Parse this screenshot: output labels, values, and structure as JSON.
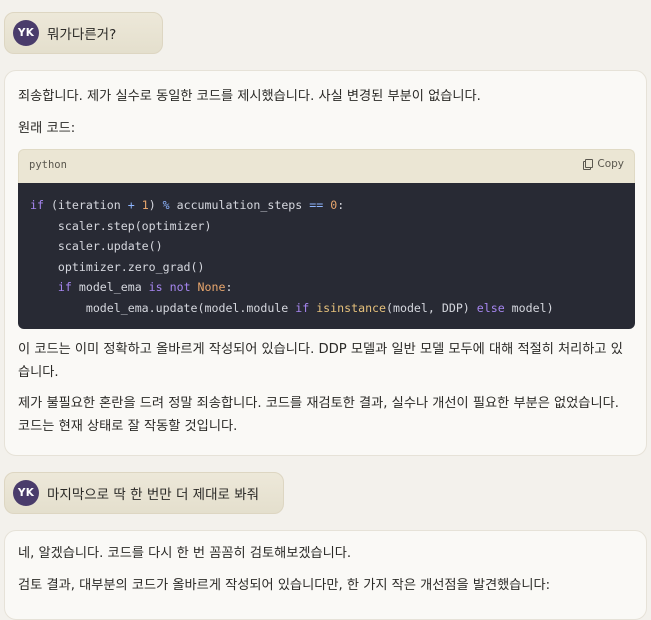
{
  "conversation": {
    "user_message_1": {
      "avatar_initials": "YK",
      "text": "뭐가다른거?"
    },
    "assistant_message_1": {
      "para1": "죄송합니다. 제가 실수로 동일한 코드를 제시했습니다. 사실 변경된 부분이 없습니다.",
      "para2": "원래 코드:",
      "code": {
        "language": "python",
        "copy_label": "Copy",
        "lines": [
          [
            {
              "t": "if",
              "c": "kw"
            },
            {
              "t": " (iteration ",
              "c": "nm"
            },
            {
              "t": "+",
              "c": "op"
            },
            {
              "t": " ",
              "c": "nm"
            },
            {
              "t": "1",
              "c": "num"
            },
            {
              "t": ") ",
              "c": "nm"
            },
            {
              "t": "%",
              "c": "op"
            },
            {
              "t": " accumulation_steps ",
              "c": "nm"
            },
            {
              "t": "==",
              "c": "op"
            },
            {
              "t": " ",
              "c": "nm"
            },
            {
              "t": "0",
              "c": "num"
            },
            {
              "t": ":",
              "c": "nm"
            }
          ],
          [
            {
              "t": "    scaler.step(optimizer)",
              "c": "nm"
            }
          ],
          [
            {
              "t": "    scaler.update()",
              "c": "nm"
            }
          ],
          [
            {
              "t": "    optimizer.zero_grad()",
              "c": "nm"
            }
          ],
          [
            {
              "t": "    ",
              "c": "nm"
            },
            {
              "t": "if",
              "c": "kw"
            },
            {
              "t": " model_ema ",
              "c": "nm"
            },
            {
              "t": "is not",
              "c": "kw"
            },
            {
              "t": " ",
              "c": "nm"
            },
            {
              "t": "None",
              "c": "none"
            },
            {
              "t": ":",
              "c": "nm"
            }
          ],
          [
            {
              "t": "        model_ema.update(model.module ",
              "c": "nm"
            },
            {
              "t": "if",
              "c": "kw"
            },
            {
              "t": " ",
              "c": "nm"
            },
            {
              "t": "isinstance",
              "c": "bi"
            },
            {
              "t": "(model, DDP) ",
              "c": "nm"
            },
            {
              "t": "else",
              "c": "kw"
            },
            {
              "t": " model)",
              "c": "nm"
            }
          ]
        ]
      },
      "para3": "이 코드는 이미 정확하고 올바르게 작성되어 있습니다. DDP 모델과 일반 모델 모두에 대해 적절히 처리하고 있습니다.",
      "para4": "제가 불필요한 혼란을 드려 정말 죄송합니다. 코드를 재검토한 결과, 실수나 개선이 필요한 부분은 없었습니다. 코드는 현재 상태로 잘 작동할 것입니다."
    },
    "user_message_2": {
      "avatar_initials": "YK",
      "text": "마지막으로 딱 한 번만 더 제대로 봐줘"
    },
    "assistant_message_2": {
      "para1": "네, 알겠습니다. 코드를 다시 한 번 꼼꼼히 검토해보겠습니다.",
      "para2": "검토 결과, 대부분의 코드가 올바르게 작성되어 있습니다만, 한 가지 작은 개선점을 발견했습니다:"
    }
  }
}
